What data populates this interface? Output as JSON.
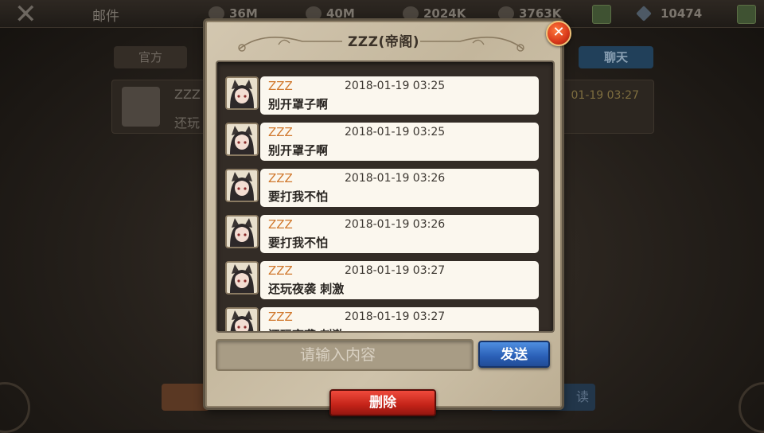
{
  "background": {
    "title": "邮件",
    "resources": [
      {
        "icon": "coin-bag-icon",
        "value": "36M"
      },
      {
        "icon": "ore-icon",
        "value": "40M"
      },
      {
        "icon": "wood-icon",
        "value": "2024K"
      },
      {
        "icon": "food-icon",
        "value": "3763K"
      },
      {
        "icon": "gem-icon",
        "value": "10474"
      }
    ],
    "tabs": {
      "official": "官方",
      "chat": "聊天"
    },
    "row": {
      "name": "ZZZ",
      "message": "还玩",
      "time": "01-19 03:27"
    },
    "right_button_label": "读"
  },
  "dialog": {
    "title": "ZZZ(帝阁)",
    "close_label": "✕",
    "messages": [
      {
        "sender": "ZZZ",
        "time": "2018-01-19  03:25",
        "text": "别开罩子啊"
      },
      {
        "sender": "ZZZ",
        "time": "2018-01-19  03:25",
        "text": "别开罩子啊"
      },
      {
        "sender": "ZZZ",
        "time": "2018-01-19  03:26",
        "text": "要打我不怕"
      },
      {
        "sender": "ZZZ",
        "time": "2018-01-19  03:26",
        "text": "要打我不怕"
      },
      {
        "sender": "ZZZ",
        "time": "2018-01-19  03:27",
        "text": "还玩夜袭 刺激"
      },
      {
        "sender": "ZZZ",
        "time": "2018-01-19  03:27",
        "text": "还玩夜袭 刺激"
      }
    ],
    "input_placeholder": "请输入内容",
    "send_label": "发送",
    "delete_label": "删除"
  },
  "colors": {
    "sender_name": "#d0782d",
    "send_button": "#2a5fb6",
    "delete_button": "#c32318",
    "parchment": "#cbbfa8"
  }
}
